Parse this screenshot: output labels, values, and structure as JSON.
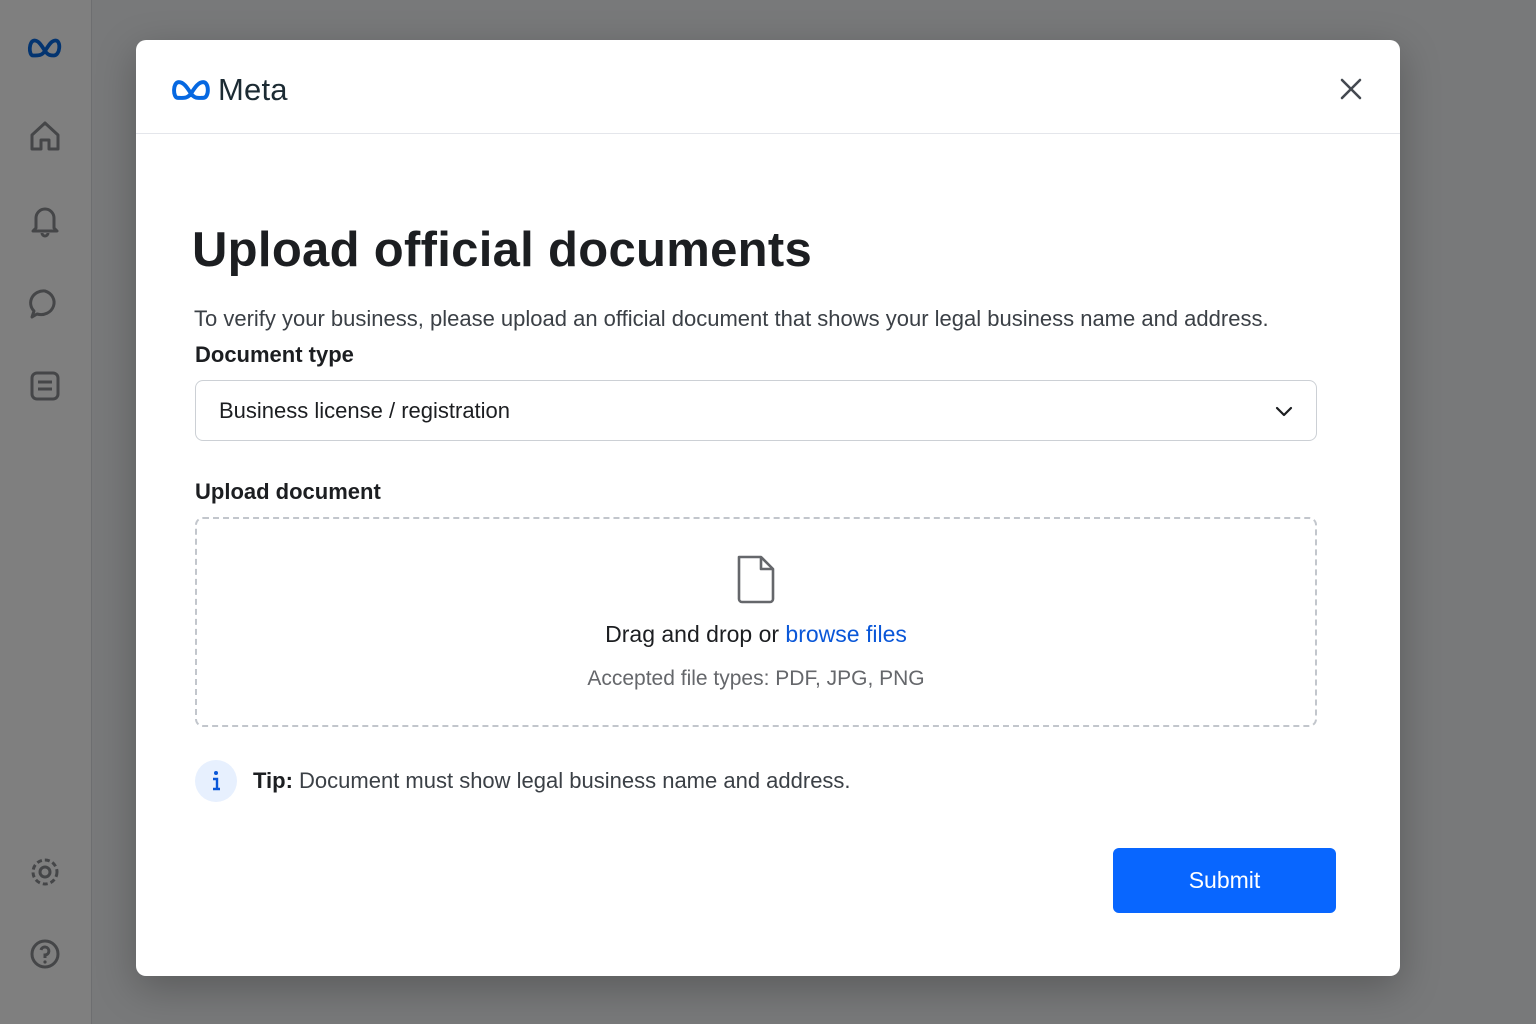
{
  "colors": {
    "accent": "#0866ff",
    "link": "#0a57d8",
    "brand_blue": "#0668e1",
    "backdrop_overlay": "rgba(0,0,0,0.5)"
  },
  "background": {
    "sidebar_icons": [
      "meta-logo-icon",
      "home-icon",
      "bell-icon",
      "chat-icon",
      "pages-icon",
      "settings-icon",
      "help-icon"
    ]
  },
  "modal": {
    "brand_name": "Meta",
    "close_icon": "close-icon",
    "title": "Upload official documents",
    "description": "To verify your business, please upload an official document that shows your legal business name and address.",
    "document_type": {
      "label": "Document type",
      "selected": "Business license / registration",
      "icon": "chevron-down-icon"
    },
    "upload": {
      "label": "Upload document",
      "icon": "file-icon",
      "drag_text": "Drag and drop or ",
      "browse_link": "browse files",
      "accepted": "Accepted file types: PDF, JPG, PNG"
    },
    "tip": {
      "icon": "info-icon",
      "label": "Tip:",
      "text": " Document must show legal business name and address."
    },
    "submit_label": "Submit"
  }
}
